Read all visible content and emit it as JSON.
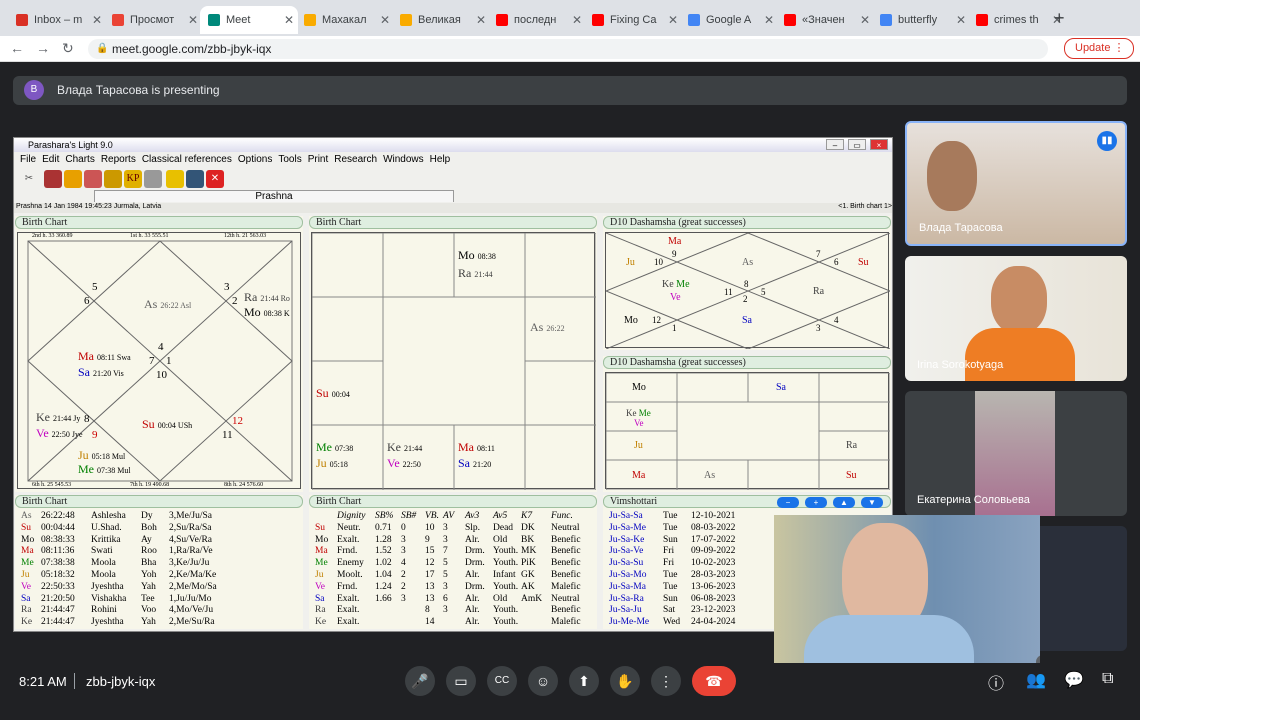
{
  "browser": {
    "tabs": [
      {
        "title": "Inbox – m",
        "color": "#d93025"
      },
      {
        "title": "Просмот",
        "color": "#ea4335"
      },
      {
        "title": "Meet",
        "color": "#00897b"
      },
      {
        "title": "Махакал",
        "color": "#f9ab00"
      },
      {
        "title": "Великая",
        "color": "#f9ab00"
      },
      {
        "title": "последн",
        "color": "#ff0000"
      },
      {
        "title": "Fixing Ca",
        "color": "#ff0000"
      },
      {
        "title": "Google A",
        "color": "#4285f4"
      },
      {
        "title": "«Значен",
        "color": "#ff0000"
      },
      {
        "title": "butterfly",
        "color": "#4285f4"
      },
      {
        "title": "crimes th",
        "color": "#ff0000"
      }
    ],
    "url": "meet.google.com/zbb-jbyk-iqx",
    "update_label": "Update"
  },
  "meet": {
    "presenter_avatar": "B",
    "banner": "Влада Тарасова is presenting",
    "time": "8:21 AM",
    "meeting_code": "zbb-jbyk-iqx",
    "participant_count": "5",
    "participants": [
      "Влада Тарасова",
      "Irina Sorokotyaga",
      "Екатерина Соловьева"
    ]
  },
  "app": {
    "title": "Parashara's Light 9.0",
    "menu": [
      "File",
      "Edit",
      "Charts",
      "Reports",
      "Classical references",
      "Options",
      "Tools",
      "Print",
      "Research",
      "Windows",
      "Help"
    ],
    "tab": "Prashna",
    "status_left": "Prashna 14 Jan 1984 19:45:23  Jurmala, Latvia",
    "status_right": "<1. Birth chart 1>",
    "panels": {
      "p1": "Birth Chart",
      "p2": "Birth Chart",
      "p3": "D10 Dashamsha  (great successes)",
      "p4": "D10 Dashamsha  (great successes)",
      "p5": "Birth Chart",
      "p6": "Birth Chart",
      "p7": "Vimshottari"
    },
    "north_edges": {
      "top": [
        "2nd h. 33 360.89",
        "1st h. 33 555.51",
        "12th h. 21 563.03"
      ],
      "bottom": [
        "6th h. 25 545.53",
        "7th h. 19 490.68",
        "8th h. 24 576.60"
      ]
    },
    "planet_table": [
      [
        "As",
        "26:22:48",
        "Ashlesha",
        "Dy",
        "3,Me/Ju/Sa"
      ],
      [
        "Su",
        "00:04:44",
        "U.Shad.",
        "Boh",
        "2,Su/Ra/Sa"
      ],
      [
        "Mo",
        "08:38:33",
        "Krittika",
        "Ay",
        "4,Su/Ve/Ra"
      ],
      [
        "Ma",
        "08:11:36",
        "Swati",
        "Roo",
        "1,Ra/Ra/Ve"
      ],
      [
        "Me",
        "07:38:38",
        "Moola",
        "Bha",
        "3,Ke/Ju/Ju"
      ],
      [
        "Ju",
        "05:18:32",
        "Moola",
        "Yoh",
        "2,Ke/Ma/Ke"
      ],
      [
        "Ve",
        "22:50:33",
        "Jyeshtha",
        "Yah",
        "2,Me/Mo/Sa"
      ],
      [
        "Sa",
        "21:20:50",
        "Vishakha",
        "Tee",
        "1,Ju/Ju/Mo"
      ],
      [
        "Ra",
        "21:44:47",
        "Rohini",
        "Voo",
        "4,Mo/Ve/Ju"
      ],
      [
        "Ke",
        "21:44:47",
        "Jyeshtha",
        "Yah",
        "2,Me/Su/Ra"
      ]
    ],
    "dignity_header": [
      "Dignity",
      "SB%",
      "SB#",
      "VB.",
      "AV",
      "Av3",
      "Av5",
      "K7",
      "Func."
    ],
    "dignity_table": [
      [
        "Su",
        "Neutr.",
        "0.71",
        "0",
        "10",
        "3",
        "Slp.",
        "Dead",
        "DK",
        "Neutral"
      ],
      [
        "Mo",
        "Exalt.",
        "1.28",
        "3",
        "9",
        "3",
        "Alr.",
        "Old",
        "BK",
        "Benefic"
      ],
      [
        "Ma",
        "Frnd.",
        "1.52",
        "3",
        "15",
        "7",
        "Drm.",
        "Youth.",
        "MK",
        "Benefic"
      ],
      [
        "Me",
        "Enemy",
        "1.02",
        "4",
        "12",
        "5",
        "Drm.",
        "Youth.",
        "PiK",
        "Benefic"
      ],
      [
        "Ju",
        "Moolt.",
        "1.04",
        "2",
        "17",
        "5",
        "Alr.",
        "Infant",
        "GK",
        "Benefic"
      ],
      [
        "Ve",
        "Frnd.",
        "1.24",
        "2",
        "13",
        "3",
        "Drm.",
        "Youth.",
        "AK",
        "Malefic"
      ],
      [
        "Sa",
        "Exalt.",
        "1.66",
        "3",
        "13",
        "6",
        "Alr.",
        "Old",
        "AmK",
        "Neutral"
      ],
      [
        "Ra",
        "Exalt.",
        "",
        "",
        "8",
        "3",
        "Alr.",
        "Youth.",
        "",
        "Benefic"
      ],
      [
        "Ke",
        "Exalt.",
        "",
        "",
        "14",
        "",
        "Alr.",
        "Youth.",
        "",
        "Malefic"
      ]
    ],
    "vimshottari": [
      [
        "Ju-Sa-Sa",
        "Tue",
        "12-10-2021"
      ],
      [
        "Ju-Sa-Me",
        "Tue",
        "08-03-2022"
      ],
      [
        "Ju-Sa-Ke",
        "Sun",
        "17-07-2022"
      ],
      [
        "Ju-Sa-Ve",
        "Fri",
        "09-09-2022"
      ],
      [
        "Ju-Sa-Su",
        "Fri",
        "10-02-2023"
      ],
      [
        "Ju-Sa-Mo",
        "Tue",
        "28-03-2023"
      ],
      [
        "Ju-Sa-Ma",
        "Tue",
        "13-06-2023"
      ],
      [
        "Ju-Sa-Ra",
        "Sun",
        "06-08-2023"
      ],
      [
        "Ju-Sa-Ju",
        "Sat",
        "23-12-2023"
      ],
      [
        "Ju-Me-Me",
        "Wed",
        "24-04-2024"
      ]
    ],
    "colors": {
      "Su": "#c00000",
      "Mo": "#000000",
      "Ma": "#c00000",
      "Me": "#008000",
      "Ju": "#c08000",
      "Ve": "#c000c0",
      "Sa": "#0000c0",
      "Ra": "#404040",
      "Ke": "#404040",
      "As": "#606060"
    }
  }
}
